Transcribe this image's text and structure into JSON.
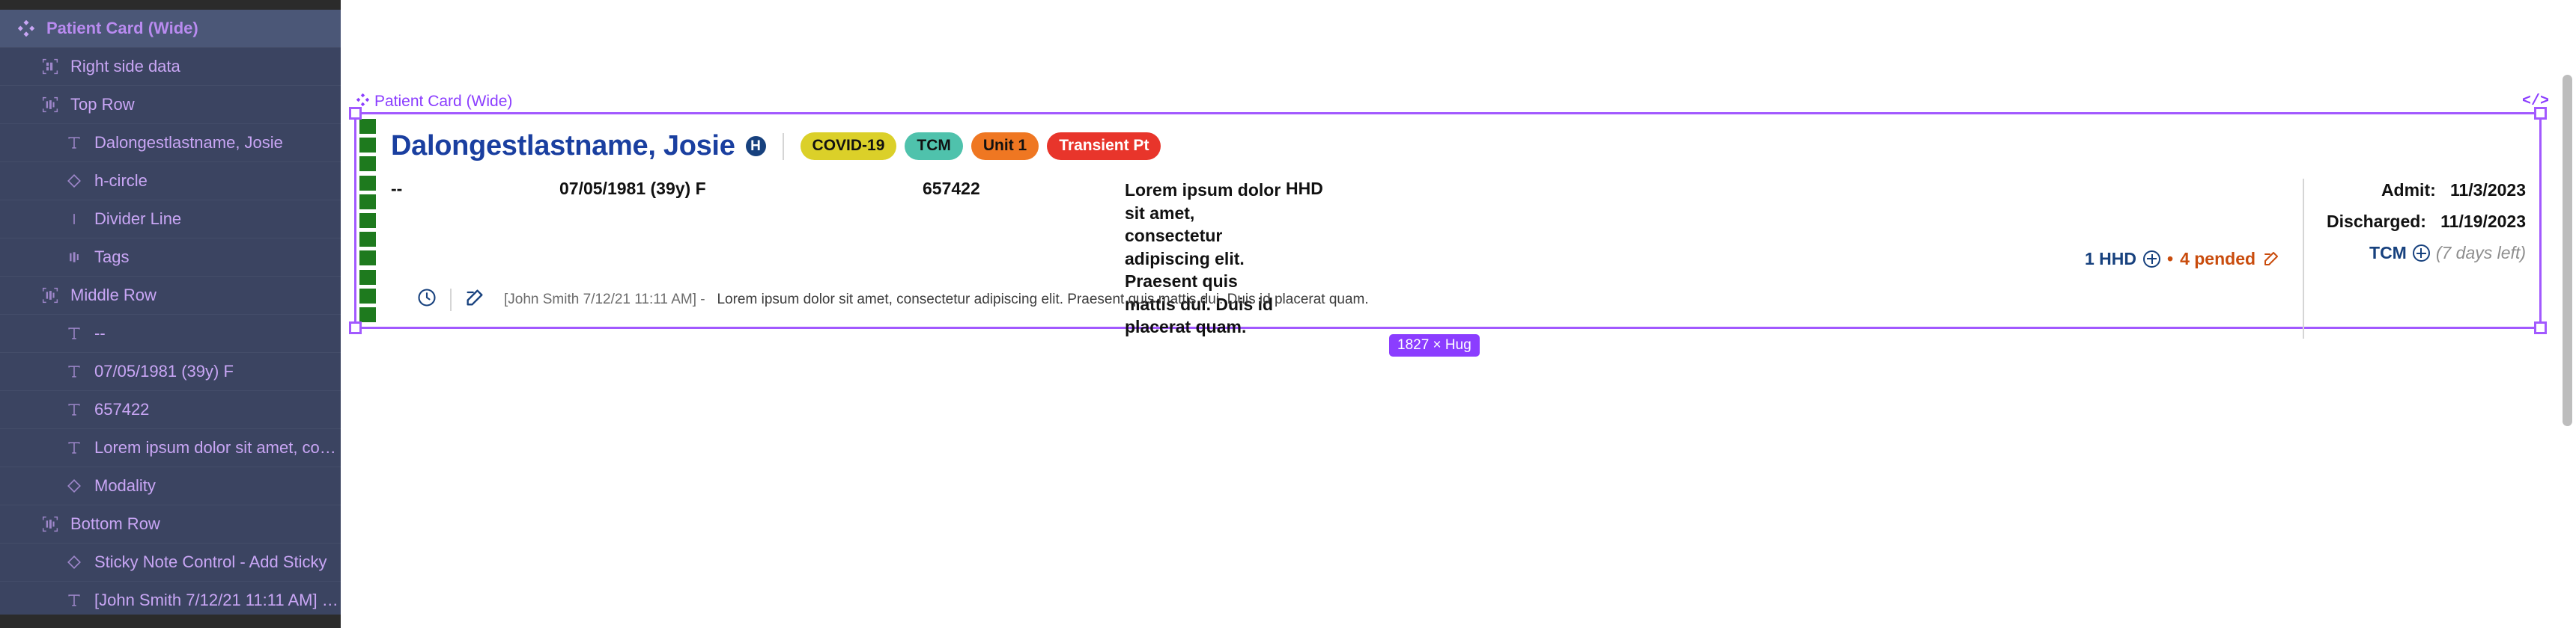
{
  "layers_panel": {
    "rows": [
      {
        "label": "Patient Card (Wide)",
        "icon": "component-diamond-icon",
        "depth": 0,
        "selected": true
      },
      {
        "label": "Right side data",
        "icon": "autolayout-vertical-icon",
        "depth": 1,
        "selected": false
      },
      {
        "label": "Top Row",
        "icon": "autolayout-horizontal-icon",
        "depth": 1,
        "selected": false
      },
      {
        "label": "Dalongestlastname, Josie",
        "icon": "text-icon",
        "depth": 2,
        "selected": false
      },
      {
        "label": "h-circle",
        "icon": "instance-diamond-icon",
        "depth": 2,
        "selected": false
      },
      {
        "label": "Divider Line",
        "icon": "line-icon",
        "depth": 2,
        "selected": false
      },
      {
        "label": "Tags",
        "icon": "frame-horizontal-icon",
        "depth": 2,
        "selected": false
      },
      {
        "label": "Middle Row",
        "icon": "autolayout-horizontal-icon",
        "depth": 1,
        "selected": false
      },
      {
        "label": "--",
        "icon": "text-icon",
        "depth": 2,
        "selected": false
      },
      {
        "label": "07/05/1981 (39y) F",
        "icon": "text-icon",
        "depth": 2,
        "selected": false
      },
      {
        "label": "657422",
        "icon": "text-icon",
        "depth": 2,
        "selected": false
      },
      {
        "label": "Lorem ipsum dolor sit amet, cons...",
        "icon": "text-icon",
        "depth": 2,
        "selected": false
      },
      {
        "label": "Modality",
        "icon": "instance-diamond-icon",
        "depth": 2,
        "selected": false
      },
      {
        "label": "Bottom Row",
        "icon": "autolayout-horizontal-icon",
        "depth": 1,
        "selected": false
      },
      {
        "label": "Sticky Note Control - Add Sticky",
        "icon": "instance-diamond-icon",
        "depth": 2,
        "selected": false
      },
      {
        "label": "[John Smith 7/12/21 11:11 AM] - L...",
        "icon": "text-icon",
        "depth": 2,
        "selected": false
      }
    ]
  },
  "canvas": {
    "frame_label": "Patient Card (Wide)",
    "frame_label_icon": "component-diamond-icon",
    "code_icon": "code-brackets-icon",
    "size_badge": "1827 × Hug",
    "accent_color": "#8b3dff"
  },
  "card": {
    "top_row": {
      "patient_name": "Dalongestlastname, Josie",
      "h_badge": "H",
      "tags": [
        {
          "label": "COVID-19",
          "bg": "#dbd029",
          "fg": "#111111"
        },
        {
          "label": "TCM",
          "bg": "#4fc2ac",
          "fg": "#111111"
        },
        {
          "label": "Unit 1",
          "bg": "#ef7722",
          "fg": "#111111"
        },
        {
          "label": "Transient Pt",
          "bg": "#e8352b",
          "fg": "#ffffff"
        }
      ]
    },
    "middle_row": {
      "dash": "--",
      "dob": "07/05/1981 (39y) F",
      "mrn": "657422",
      "description": "Lorem ipsum dolor sit amet, consectetur adipiscing elit. Praesent quis mattis dui. Duis id placerat quam.",
      "modality": "HHD",
      "hhd_count": "1 HHD",
      "bullet": "•",
      "pended": "4 pended",
      "add_icon": "plus-circle-icon",
      "edit_icon": "pencil-square-icon"
    },
    "right_data": {
      "admit_label": "Admit:",
      "admit_value": "11/3/2023",
      "discharged_label": "Discharged:",
      "discharged_value": "11/19/2023",
      "tcm_label": "TCM",
      "tcm_add_icon": "plus-circle-icon",
      "tcm_days": "(7 days left)"
    },
    "bottom_row": {
      "clock_icon": "clock-icon",
      "edit_icon": "pencil-square-icon",
      "note_meta": "[John Smith 7/12/21 11:11 AM] -",
      "note_text": "Lorem ipsum dolor sit amet, consectetur adipiscing elit. Praesent quis mattis dui. Duis id placerat quam."
    }
  }
}
